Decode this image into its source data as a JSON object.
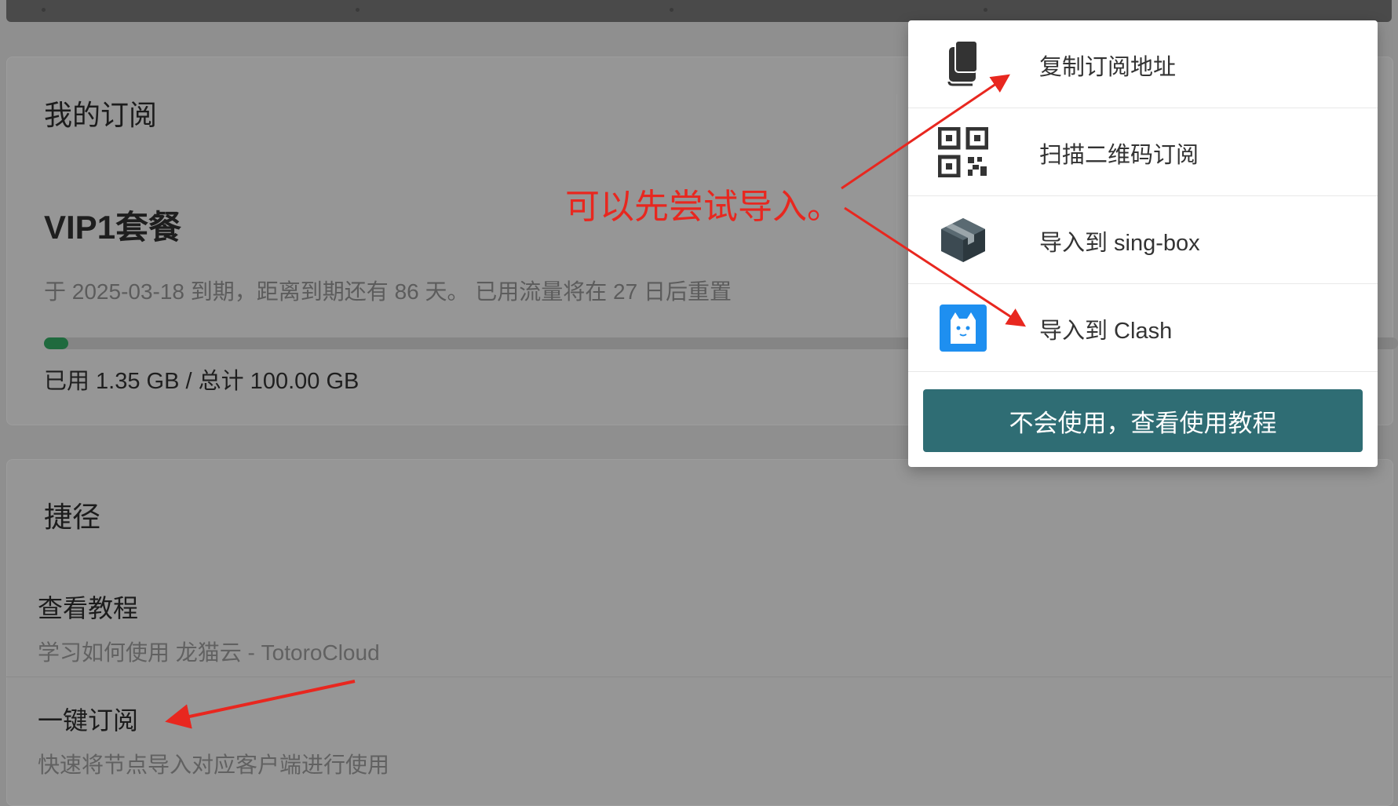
{
  "subscription": {
    "title": "我的订阅",
    "plan_name": "VIP1套餐",
    "expire_text": "于 2025-03-18 到期，距离到期还有 86 天。 已用流量将在 27 日后重置",
    "usage_text": "已用 1.35 GB / 总计 100.00 GB",
    "usage_fraction": 0.0135
  },
  "shortcuts": {
    "title": "捷径",
    "items": [
      {
        "name": "查看教程",
        "desc": "学习如何使用 龙猫云 - TotoroCloud"
      },
      {
        "name": "一键订阅",
        "desc": "快速将节点导入对应客户端进行使用"
      }
    ]
  },
  "menu": {
    "items": [
      {
        "label": "复制订阅地址",
        "icon": "copy-icon"
      },
      {
        "label": "扫描二维码订阅",
        "icon": "qr-code-icon"
      },
      {
        "label": "导入到 sing-box",
        "icon": "box-icon"
      },
      {
        "label": "导入到 Clash",
        "icon": "clash-cat-icon"
      }
    ],
    "tutorial_button": "不会使用，查看使用教程"
  },
  "annotation": {
    "text": "可以先尝试导入。",
    "color": "#e8271f"
  },
  "colors": {
    "accent_button": "#2f6d74",
    "progress_fill": "#1f6a3e",
    "clash_blue": "#1e8ff0"
  }
}
